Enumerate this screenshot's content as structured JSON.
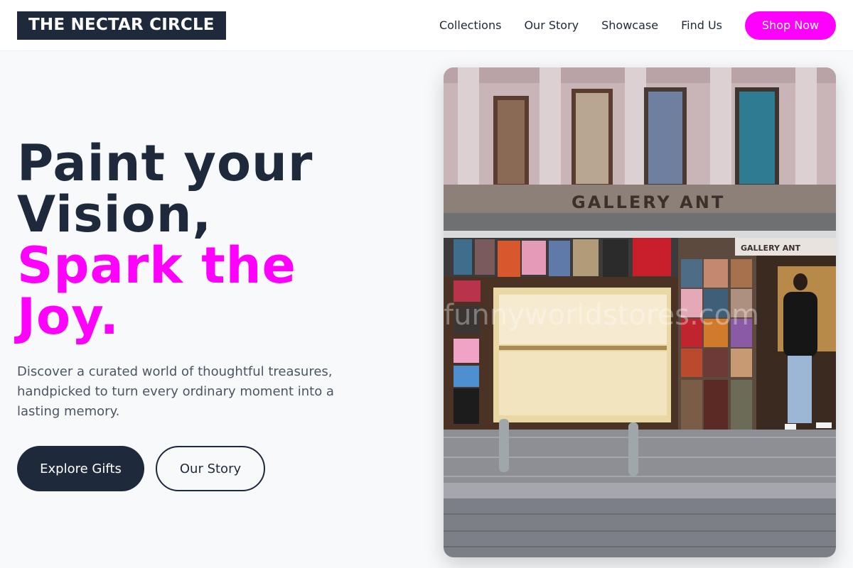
{
  "header": {
    "logo": "THE NECTAR CIRCLE",
    "nav": [
      "Collections",
      "Our Story",
      "Showcase",
      "Find Us"
    ],
    "cta": "Shop Now"
  },
  "hero": {
    "headline_line1": "Paint your",
    "headline_line2": "Vision,",
    "headline_accent1": "Spark the",
    "headline_accent2": "Joy.",
    "subtext": "Discover a curated world of thoughtful treasures, handpicked to turn every ordinary moment into a lasting memory.",
    "primary_button": "Explore Gifts",
    "secondary_button": "Our Story"
  },
  "image": {
    "sign_text": "GALLERY ANT",
    "small_sign_text": "GALLERY ANT",
    "watermark": "funnyworldstores.com"
  },
  "colors": {
    "brand_dark": "#1e293b",
    "accent": "#ff00ff",
    "background": "#f8f9fb"
  }
}
